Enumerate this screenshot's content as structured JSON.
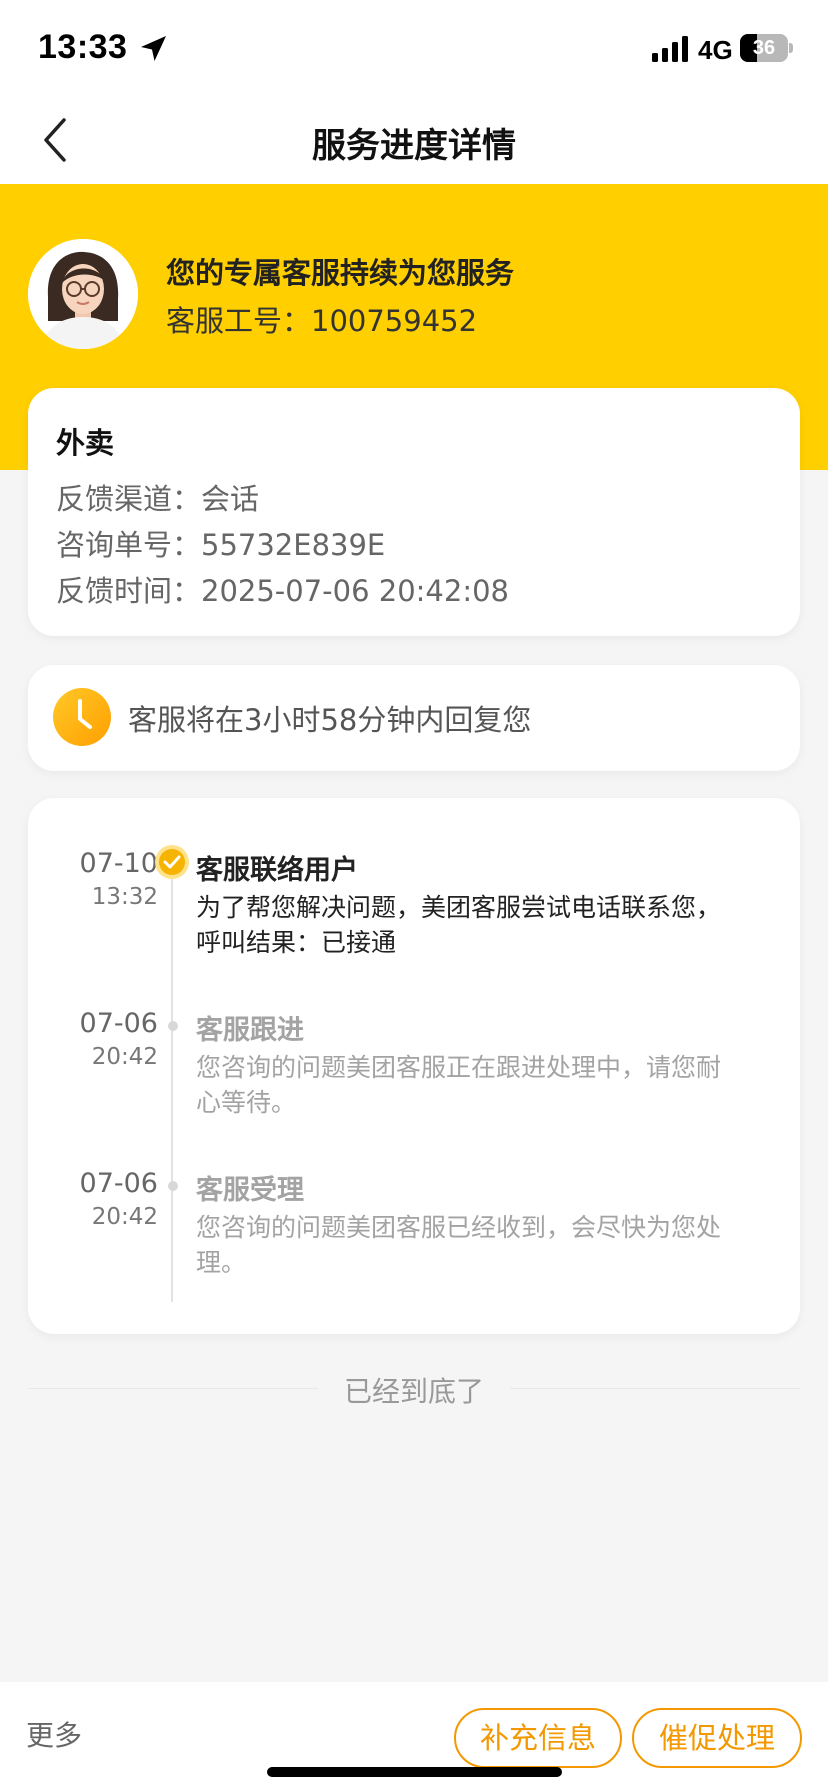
{
  "status_bar": {
    "time": "13:33",
    "network": "4G",
    "battery_level": 36,
    "battery_text": "36",
    "icons": [
      "location-arrow-icon",
      "signal-icon",
      "battery-icon"
    ]
  },
  "nav": {
    "title": "服务进度详情",
    "back_icon": "chevron-left-icon"
  },
  "header": {
    "background_color": "#ffcf00",
    "agent_title": "您的专属客服持续为您服务",
    "agent_id_label": "客服工号：",
    "agent_id": "100759452",
    "agent_id_text": "客服工号：100759452"
  },
  "info_card": {
    "title": "外卖",
    "rows": [
      {
        "label": "反馈渠道：",
        "value": "会话",
        "text": "反馈渠道：会话"
      },
      {
        "label": "咨询单号：",
        "value": "55732E839E",
        "text": "咨询单号：55732E839E"
      },
      {
        "label": "反馈时间：",
        "value": "2025-07-06 20:42:08",
        "text": "反馈时间：2025-07-06 20:42:08"
      }
    ]
  },
  "timer": {
    "icon": "clock-icon",
    "text": "客服将在3小时58分钟内回复您"
  },
  "timeline": [
    {
      "date": "07-10",
      "time": "13:32",
      "title": "客服联络用户",
      "description": "为了帮您解决问题，美团客服尝试电话联系您，呼叫结果：已接通",
      "line1": "为了帮您解决问题，美团客服尝试电话联系您，",
      "line2": "呼叫结果：已接通",
      "state": "active"
    },
    {
      "date": "07-06",
      "time": "20:42",
      "title": "客服跟进",
      "description": "您咨询的问题美团客服正在跟进处理中，请您耐心等待。",
      "line1": "您咨询的问题美团客服正在跟进处理中，请您耐",
      "line2": "心等待。",
      "state": "done"
    },
    {
      "date": "07-06",
      "time": "20:42",
      "title": "客服受理",
      "description": "您咨询的问题美团客服已经收到，会尽快为您处理。",
      "line1": "您咨询的问题美团客服已经收到，会尽快为您处",
      "line2": "理。",
      "state": "done"
    }
  ],
  "end_text": "已经到底了",
  "bottom_bar": {
    "more_label": "更多",
    "supplement_label": "补充信息",
    "urge_label": "催促处理",
    "accent_color": "#f39800"
  }
}
